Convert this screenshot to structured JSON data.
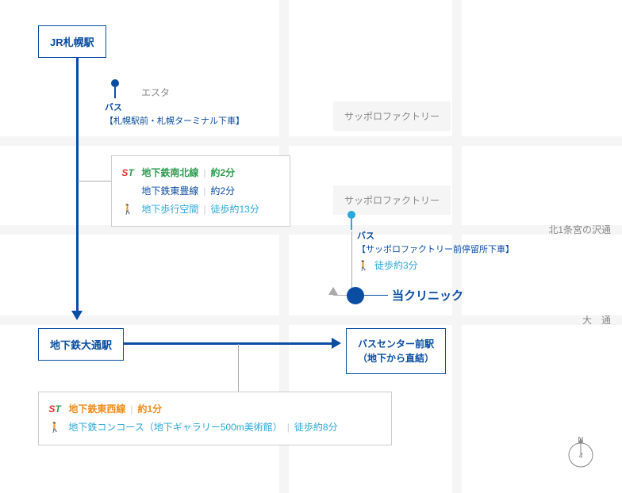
{
  "stations": {
    "jr_sapporo": "JR札幌駅",
    "odori": "地下鉄大通駅",
    "bus_center_l1": "バスセンター前駅",
    "bus_center_l2": "（地下から直結）"
  },
  "landmarks": {
    "esta": "エスタ",
    "factory1": "サッポロファクトリー",
    "factory2": "サッポロファクトリー"
  },
  "roads": {
    "kita1jo": "北1条宮の沢通",
    "odori": "大　通"
  },
  "bus": {
    "label": "バス",
    "sapporo_stop": "【札幌駅前・札幌ターミナル下車】",
    "factory_stop": "【サッポロファクトリー前停留所下車】",
    "factory_walk": "徒歩約3分"
  },
  "clinic": "当クリニック",
  "transit_box1": {
    "line1_name": "地下鉄南北線",
    "line1_time": "約2分",
    "line2_name": "地下鉄東豊線",
    "line2_time": "約2分",
    "walk_name": "地下歩行空間",
    "walk_time": "徒歩約13分"
  },
  "transit_box2": {
    "line_name": "地下鉄東西線",
    "line_time": "約1分",
    "walk_name": "地下鉄コンコース（地下ギャラリー500m美術館）",
    "walk_time": "徒歩約8分"
  },
  "icons": {
    "st": "ST",
    "walk": "🚶",
    "compass": "N"
  }
}
